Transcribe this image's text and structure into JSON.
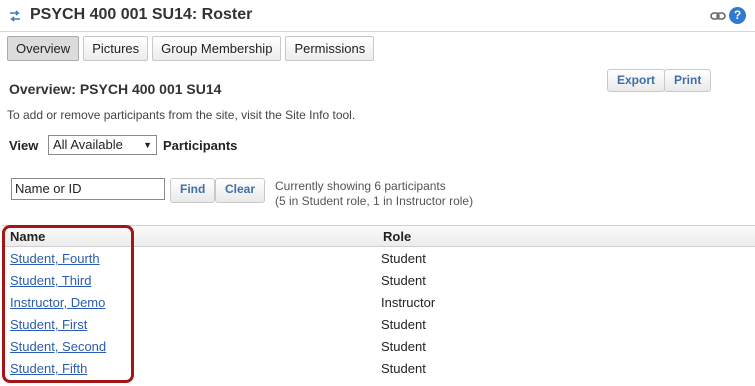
{
  "header": {
    "title": "PSYCH 400 001 SU14: Roster",
    "help_glyph": "?"
  },
  "tabs": [
    {
      "label": "Overview",
      "active": true
    },
    {
      "label": "Pictures",
      "active": false
    },
    {
      "label": "Group Membership",
      "active": false
    },
    {
      "label": "Permissions",
      "active": false
    }
  ],
  "overview": {
    "title": "Overview: PSYCH 400 001 SU14",
    "export_label": "Export",
    "print_label": "Print",
    "info": "To add or remove participants from the site, visit the Site Info tool."
  },
  "view": {
    "label": "View",
    "selected": "All Available",
    "suffix": "Participants"
  },
  "search": {
    "value": "Name or ID",
    "find_label": "Find",
    "clear_label": "Clear",
    "showing_line1": "Currently showing 6 participants",
    "showing_line2": "(5 in Student role, 1 in Instructor role)"
  },
  "table": {
    "headers": {
      "name": "Name",
      "role": "Role"
    },
    "rows": [
      {
        "name": "Student, Fourth",
        "role": "Student"
      },
      {
        "name": "Student, Third",
        "role": "Student"
      },
      {
        "name": "Instructor, Demo",
        "role": "Instructor"
      },
      {
        "name": "Student, First",
        "role": "Student"
      },
      {
        "name": "Student, Second",
        "role": "Student"
      },
      {
        "name": "Student, Fifth",
        "role": "Student"
      }
    ]
  },
  "colors": {
    "link": "#2a5db0",
    "button_text": "#3f6fa8",
    "highlight": "#a41515"
  }
}
